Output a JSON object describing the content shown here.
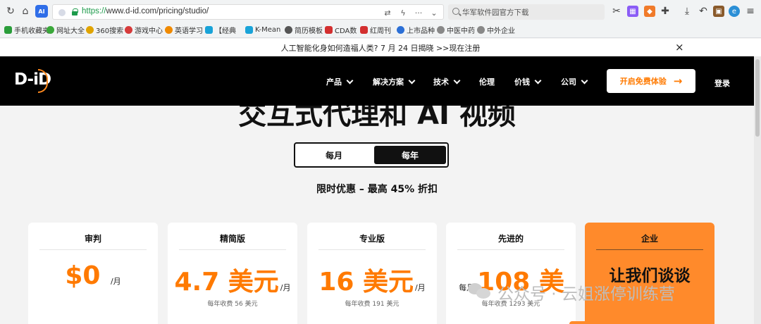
{
  "browser": {
    "url_scheme": "https://",
    "url_rest": "www.d-id.com/pricing/studio/",
    "search_placeholder": "华军软件园官方下载",
    "bookmarks": [
      {
        "label": "手机收藏夹",
        "color": "#2a9d3a"
      },
      {
        "label": "网址大全",
        "color": "#3aa83a"
      },
      {
        "label": "360搜索",
        "color": "#e0a400"
      },
      {
        "label": "游戏中心",
        "color": "#d63b3b"
      },
      {
        "label": "英语学习",
        "color": "#f08a00"
      },
      {
        "label": "【经典",
        "color": "#19a3d8"
      },
      {
        "label": "K-Mean",
        "color": "#19a3d8"
      },
      {
        "label": "简历模板",
        "color": "#555555"
      },
      {
        "label": "CDA数",
        "color": "#d32f2f"
      },
      {
        "label": "红周刊",
        "color": "#d32f2f"
      },
      {
        "label": "上市品种",
        "color": "#2b6fd6"
      },
      {
        "label": "中医中药",
        "color": "#888888"
      },
      {
        "label": "中外企业",
        "color": "#888888"
      }
    ]
  },
  "promo": {
    "text": "人工智能化身如何造福人类? 7 月 24 日揭晓 >>现在注册",
    "close_icon": "×"
  },
  "nav": {
    "logo": "D-iD",
    "items": [
      "产品",
      "解决方案",
      "技术",
      "伦理",
      "价钱",
      "公司"
    ],
    "cta": "开启免费体验",
    "login": "登录"
  },
  "hero": {
    "title": "交互式代理和 AI 视频"
  },
  "billing": {
    "monthly": "每月",
    "yearly": "每年",
    "selected": "yearly"
  },
  "discount": "限时优惠 – 最高 45% 折扣",
  "plans": [
    {
      "name": "审判",
      "price": "$0",
      "unit": "/月",
      "note": ""
    },
    {
      "name": "精简版",
      "price": "4.7 美元",
      "unit": "/月",
      "note": "每年收费 56 美元"
    },
    {
      "name": "专业版",
      "price": "16 美元",
      "unit": "/月",
      "note": "每年收费 191 美元"
    },
    {
      "name": "先进的",
      "price": "108 美",
      "unit": "每月",
      "note": "每年收费 1293 美元"
    },
    {
      "name": "企业",
      "price": "让我们谈谈",
      "unit": "",
      "note": ""
    }
  ],
  "watermark": "公众号 · 云姐涨停训练营",
  "colors": {
    "accent": "#ff7a00",
    "enterprise_card": "#ff8a2b",
    "nav_bg": "#000000"
  }
}
